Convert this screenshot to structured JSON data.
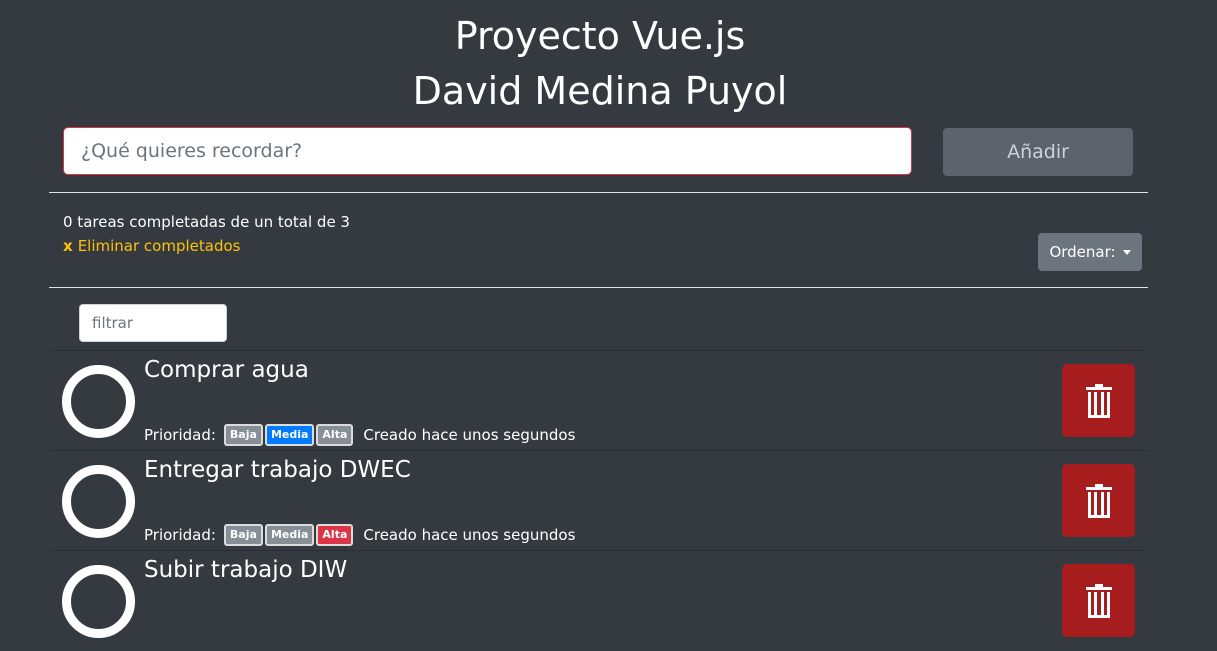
{
  "header": {
    "title_line1": "Proyecto Vue.js",
    "title_line2": "David Medina Puyol"
  },
  "new_task": {
    "placeholder": "¿Qué quieres recordar?",
    "add_label": "Añadir"
  },
  "summary": {
    "text": "0 tareas completadas de un total de 3",
    "remove_x": "x",
    "remove_label": "Eliminar completados"
  },
  "sort": {
    "label": "Ordenar:"
  },
  "filter": {
    "placeholder": "filtrar"
  },
  "priority_label": "Prioridad:",
  "tasks": [
    {
      "title": "Comprar agua",
      "priority_active": "Media",
      "created": "Creado hace unos segundos",
      "badges": [
        "Baja",
        "Media",
        "Alta"
      ]
    },
    {
      "title": "Entregar trabajo DWEC",
      "priority_active": "Alta",
      "created": "Creado hace unos segundos",
      "badges": [
        "Baja",
        "Media",
        "Alta"
      ]
    },
    {
      "title": "Subir trabajo DIW",
      "priority_active": "",
      "created": "",
      "badges": []
    }
  ],
  "colors": {
    "background": "#343a40",
    "danger": "#dc3545",
    "delete_button": "#a71d1d",
    "primary": "#007bff",
    "warning": "#ffc107",
    "secondary": "#6c757d"
  },
  "icons": {
    "delete": "trash-icon",
    "sort": "caret-down-icon",
    "complete": "circle-checkbox-icon"
  }
}
